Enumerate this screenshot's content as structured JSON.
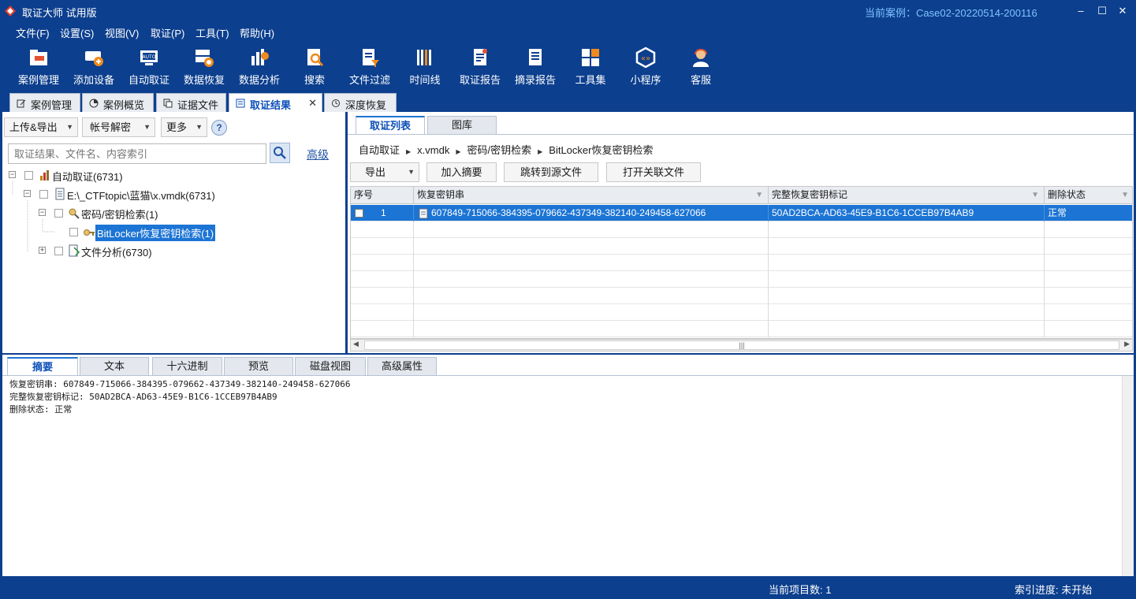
{
  "titlebar": {
    "app_title": "取证大师 试用版",
    "current_case": "当前案例：Case02-20220514-200116",
    "minimize": "–",
    "maximize": "☐",
    "close": "✕"
  },
  "menu": [
    "文件(F)",
    "设置(S)",
    "视图(V)",
    "取证(P)",
    "工具(T)",
    "帮助(H)"
  ],
  "toolbar": [
    {
      "label": "案例管理",
      "icon": "folder-icon"
    },
    {
      "label": "添加设备",
      "icon": "add-device-icon"
    },
    {
      "label": "自动取证",
      "icon": "auto-icon"
    },
    {
      "label": "数据恢复",
      "icon": "recover-icon"
    },
    {
      "label": "数据分析",
      "icon": "analysis-icon"
    },
    {
      "label": "搜索",
      "icon": "search-doc-icon"
    },
    {
      "label": "文件过滤",
      "icon": "filter-icon"
    },
    {
      "label": "时间线",
      "icon": "timeline-icon"
    },
    {
      "label": "取证报告",
      "icon": "report-icon"
    },
    {
      "label": "摘录报告",
      "icon": "excerpt-icon"
    },
    {
      "label": "工具集",
      "icon": "tools-icon"
    },
    {
      "label": "小程序",
      "icon": "miniapp-icon"
    },
    {
      "label": "客服",
      "icon": "support-icon"
    }
  ],
  "doc_tabs": [
    "案例管理",
    "案例概览",
    "证据文件",
    "取证结果",
    "深度恢复"
  ],
  "doc_tab_close": "✕",
  "left": {
    "upload_export": "上传&导出",
    "account_decrypt": "帐号解密",
    "more": "更多",
    "help": "?",
    "search_placeholder": "取证结果、文件名、内容索引",
    "advanced": "高级",
    "tree": [
      {
        "label": "自动取证(6731)",
        "expander": "−"
      },
      {
        "label": "E:\\_CTFtopic\\蓝猫\\x.vmdk(6731)",
        "expander": "−"
      },
      {
        "label": "密码/密钥检索(1)",
        "expander": "−"
      },
      {
        "label": "BitLocker恢复密钥检索(1)",
        "expander": ""
      },
      {
        "label": "文件分析(6730)",
        "expander": "+"
      }
    ]
  },
  "right": {
    "subtabs": [
      "取证列表",
      "图库"
    ],
    "breadcrumb": [
      "自动取证",
      "x.vmdk",
      "密码/密钥检索",
      "BitLocker恢复密钥检索"
    ],
    "crumb_sep": "▶",
    "actions": {
      "export": "导出",
      "add_summary": "加入摘要",
      "jump_source": "跳转到源文件",
      "open_related": "打开关联文件"
    },
    "columns": [
      "序号",
      "恢复密钥串",
      "完整恢复密钥标记",
      "删除状态"
    ],
    "filter_glyph": "▼",
    "rows": [
      {
        "index": "1",
        "key": "607849-715066-384395-079662-437349-382140-249458-627066",
        "marker": "50AD2BCA-AD63-45E9-B1C6-1CCEB97B4AB9",
        "status": "正常"
      }
    ],
    "scroll_grip": "|||"
  },
  "bottom": {
    "tabs": [
      "摘要",
      "文本",
      "十六进制",
      "预览",
      "磁盘视图",
      "高级属性"
    ],
    "details": [
      "恢复密钥串: 607849-715066-384395-079662-437349-382140-249458-627066",
      "完整恢复密钥标记: 50AD2BCA-AD63-45E9-B1C6-1CCEB97B4AB9",
      "删除状态: 正常"
    ]
  },
  "status": {
    "item_count": "当前项目数: 1",
    "index_progress": "索引进度: 未开始"
  },
  "colors": {
    "frame": "#0c3f8e",
    "selection": "#1c74d4",
    "accent_text": "#0c4fb8"
  }
}
